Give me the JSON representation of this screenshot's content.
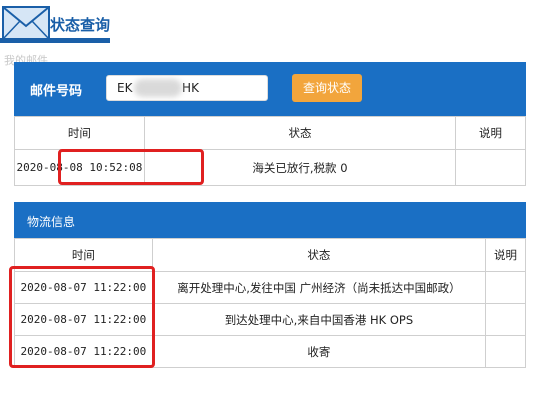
{
  "header": {
    "title": "状态查询",
    "subtitle_faded": "我的邮件"
  },
  "search": {
    "label": "邮件号码",
    "input_value": "EK             HK",
    "button_label": "查询状态"
  },
  "status_table": {
    "headers": [
      "时间",
      "状态",
      "说明"
    ],
    "rows": [
      {
        "time": "2020-08-08 10:52:08",
        "status": "海关已放行,税款 0",
        "note": ""
      }
    ]
  },
  "logistics": {
    "section_title": "物流信息",
    "headers": [
      "时间",
      "状态",
      "说明"
    ],
    "rows": [
      {
        "time": "2020-08-07 11:22:00",
        "status": "离开处理中心,发往中国 广州经济（尚未抵达中国邮政）",
        "note": ""
      },
      {
        "time": "2020-08-07 11:22:00",
        "status": "到达处理中心,来自中国香港 HK OPS",
        "note": ""
      },
      {
        "time": "2020-08-07 11:22:00",
        "status": "收寄",
        "note": ""
      }
    ]
  },
  "colors": {
    "brand_blue": "#1a6fc4",
    "button_orange": "#f2a53c",
    "highlight_red": "#e02020"
  }
}
